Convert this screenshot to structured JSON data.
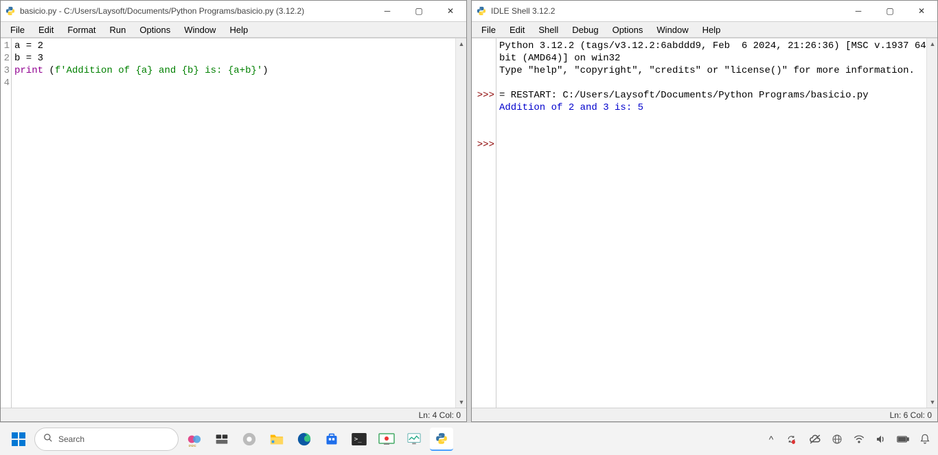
{
  "editor": {
    "title": "basicio.py - C:/Users/Laysoft/Documents/Python Programs/basicio.py (3.12.2)",
    "menus": [
      "File",
      "Edit",
      "Format",
      "Run",
      "Options",
      "Window",
      "Help"
    ],
    "line_numbers": [
      "1",
      "2",
      "3",
      "4"
    ],
    "code": {
      "l1_var": "a = ",
      "l1_val": "2",
      "l2_var": "b = ",
      "l2_val": "3",
      "l3_print": "print",
      "l3_open": " (",
      "l3_str": "f'Addition of {a} and {b} is: {a+b}'",
      "l3_close": ")"
    },
    "status": "Ln: 4  Col: 0"
  },
  "shell": {
    "title": "IDLE Shell 3.12.2",
    "menus": [
      "File",
      "Edit",
      "Shell",
      "Debug",
      "Options",
      "Window",
      "Help"
    ],
    "banner_l1": "Python 3.12.2 (tags/v3.12.2:6abddd9, Feb  6 2024, 21:26:36) [MSC v.1937 64 bit (AMD64)] on win32",
    "banner_l2": "Type \"help\", \"copyright\", \"credits\" or \"license()\" for more information.",
    "restart": "= RESTART: C:/Users/Laysoft/Documents/Python Programs/basicio.py",
    "output": "Addition of 2 and 3 is: 5",
    "prompt": ">>>",
    "status": "Ln: 6  Col: 0"
  },
  "taskbar": {
    "search_placeholder": "Search"
  }
}
